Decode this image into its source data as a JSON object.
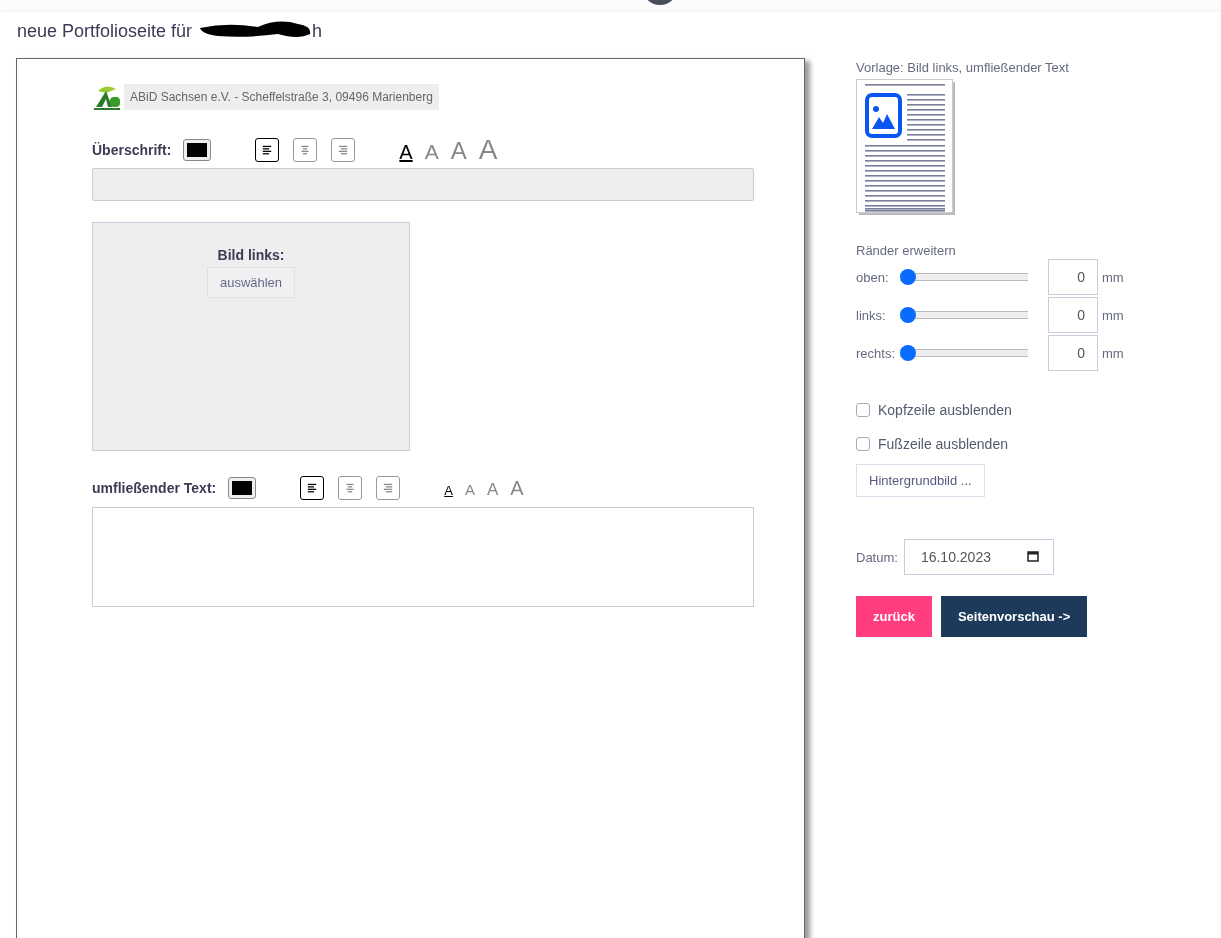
{
  "header": {
    "title": "neue Portfolioseite für",
    "title_end": "h"
  },
  "editor": {
    "letterhead": "ABiD Sachsen e.V. - Scheffelstraße 3, 09496 Marienberg",
    "heading": {
      "label": "Überschrift:",
      "color": "#000000",
      "align": [
        {
          "kind": "left",
          "selected": true
        },
        {
          "kind": "center",
          "selected": false
        },
        {
          "kind": "right",
          "selected": false
        }
      ],
      "sizes": [
        {
          "label": "A",
          "selected": true
        },
        {
          "label": "A",
          "selected": false
        },
        {
          "label": "A",
          "selected": false
        },
        {
          "label": "A",
          "selected": false
        }
      ]
    },
    "image": {
      "label": "Bild links:",
      "button": "auswählen"
    },
    "body": {
      "label": "umfließender Text:",
      "color": "#000000",
      "align": [
        {
          "kind": "left",
          "selected": true
        },
        {
          "kind": "center",
          "selected": false
        },
        {
          "kind": "right",
          "selected": false
        }
      ],
      "sizes": [
        {
          "label": "A",
          "selected": true
        },
        {
          "label": "A",
          "selected": false
        },
        {
          "label": "A",
          "selected": false
        },
        {
          "label": "A",
          "selected": false
        }
      ]
    }
  },
  "sidebar": {
    "template_label": "Vorlage: Bild links, umfließender Text",
    "margins_title": "Ränder erweitern",
    "margins": [
      {
        "label": "oben:",
        "level": 0,
        "value": "0",
        "unit": "mm"
      },
      {
        "label": "links:",
        "level": 0,
        "value": "0",
        "unit": "mm"
      },
      {
        "label": "rechts:",
        "level": 0,
        "value": "0",
        "unit": "mm"
      }
    ],
    "checkboxes": [
      {
        "label": "Kopfzeile ausblenden",
        "checked": false
      },
      {
        "label": "Fußzeile ausblenden",
        "checked": false
      }
    ],
    "background_button": "Hintergrundbild ...",
    "date": {
      "label": "Datum:",
      "value": "16.10.2023"
    },
    "buttons": [
      {
        "label": "zurück",
        "kind": "secondary"
      },
      {
        "label": "Seitenvorschau ->",
        "kind": "primary"
      }
    ]
  }
}
